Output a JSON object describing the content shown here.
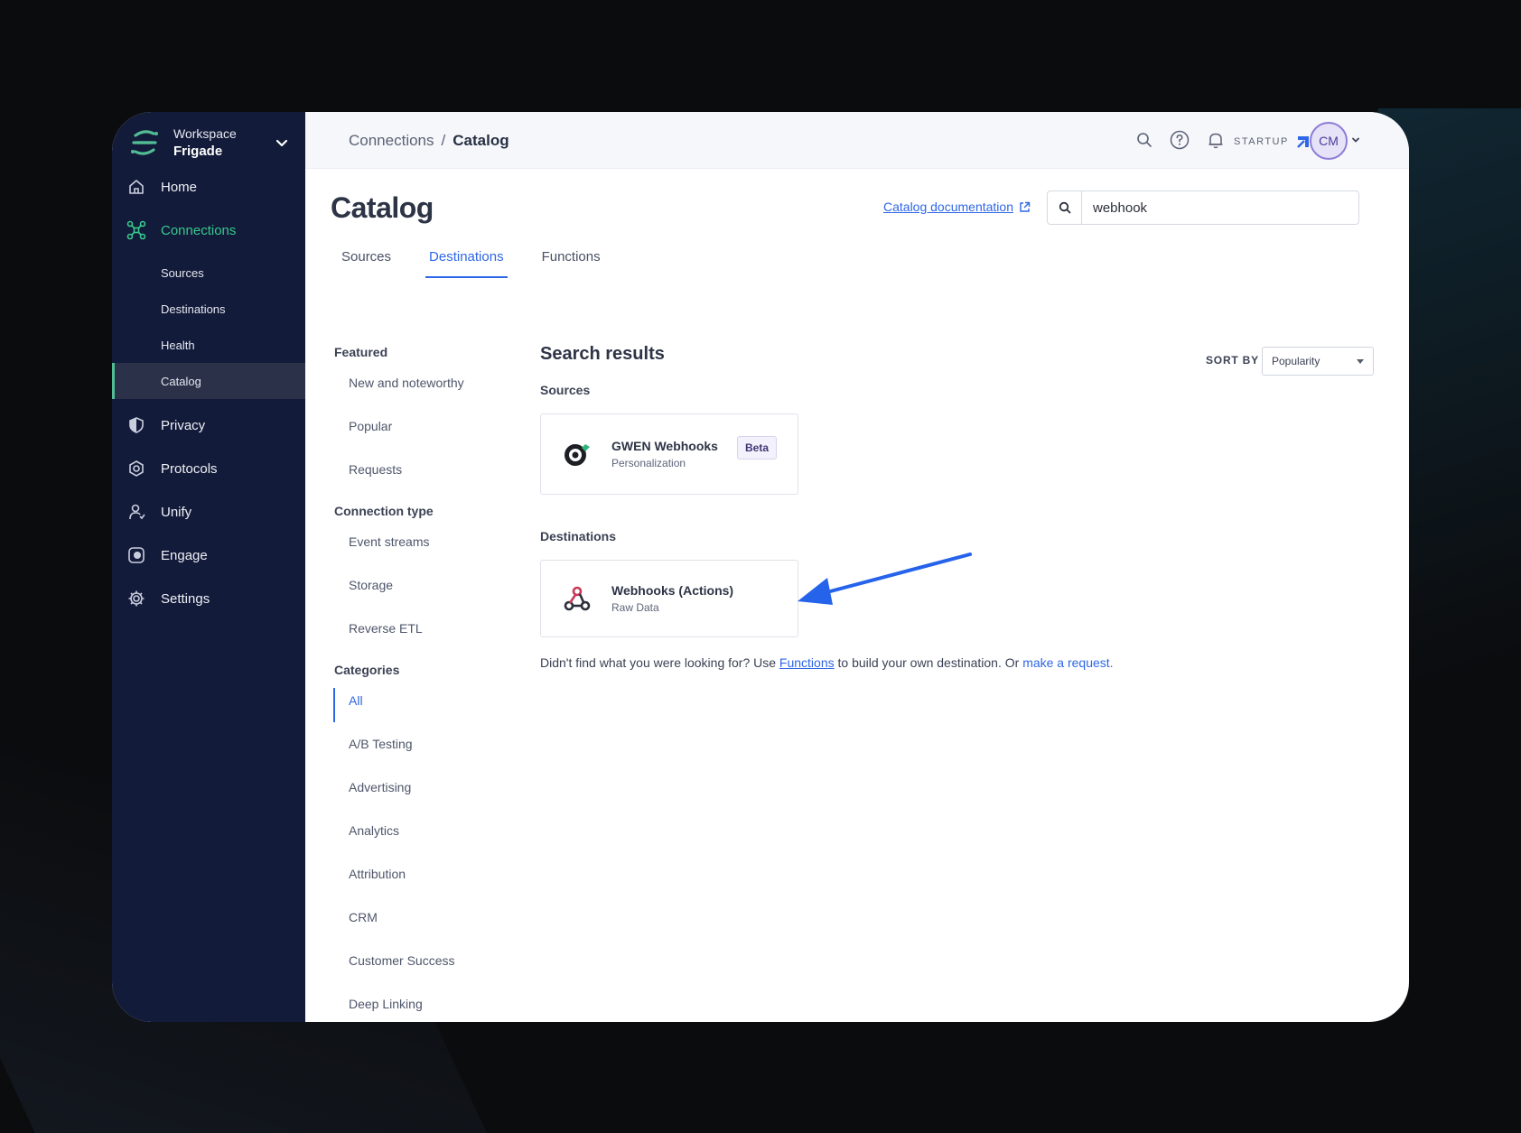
{
  "workspace": {
    "label": "Workspace",
    "name": "Frigade"
  },
  "sidebar": {
    "items": [
      {
        "label": "Home",
        "icon": "home-icon"
      },
      {
        "label": "Connections",
        "icon": "connections-icon",
        "active": true
      },
      {
        "label": "Privacy",
        "icon": "shield-icon"
      },
      {
        "label": "Protocols",
        "icon": "protocols-icon"
      },
      {
        "label": "Unify",
        "icon": "unify-icon"
      },
      {
        "label": "Engage",
        "icon": "engage-icon"
      },
      {
        "label": "Settings",
        "icon": "gear-icon"
      }
    ],
    "subitems": [
      {
        "label": "Sources"
      },
      {
        "label": "Destinations"
      },
      {
        "label": "Health"
      },
      {
        "label": "Catalog",
        "active": true
      }
    ]
  },
  "header": {
    "breadcrumb_parent": "Connections",
    "breadcrumb_sep": "/",
    "breadcrumb_current": "Catalog",
    "plan": "STARTUP",
    "avatar_initials": "CM"
  },
  "page": {
    "title": "Catalog",
    "doc_link": "Catalog documentation",
    "search_value": "webhook",
    "tabs": [
      {
        "label": "Sources"
      },
      {
        "label": "Destinations",
        "active": true
      },
      {
        "label": "Functions"
      }
    ]
  },
  "filters": {
    "featured_heading": "Featured",
    "featured": [
      "New and noteworthy",
      "Popular",
      "Requests"
    ],
    "connection_heading": "Connection type",
    "connection": [
      "Event streams",
      "Storage",
      "Reverse ETL"
    ],
    "categories_heading": "Categories",
    "categories": [
      "All",
      "A/B Testing",
      "Advertising",
      "Analytics",
      "Attribution",
      "CRM",
      "Customer Success",
      "Deep Linking"
    ]
  },
  "results": {
    "title": "Search results",
    "sort_label": "SORT BY",
    "sort_value": "Popularity",
    "sources_heading": "Sources",
    "sources": [
      {
        "name": "GWEN Webhooks",
        "category": "Personalization",
        "badge": "Beta"
      }
    ],
    "destinations_heading": "Destinations",
    "destinations": [
      {
        "name": "Webhooks (Actions)",
        "category": "Raw Data"
      }
    ],
    "footnote_pre": "Didn't find what you were looking for? Use ",
    "footnote_link": "Functions",
    "footnote_mid": " to build your own destination. Or ",
    "footnote_request": "make a request."
  },
  "colors": {
    "sidebar_bg": "#131b3a",
    "accent_green": "#38c98d",
    "accent_blue": "#2e67e6",
    "arrow": "#2563eb"
  }
}
